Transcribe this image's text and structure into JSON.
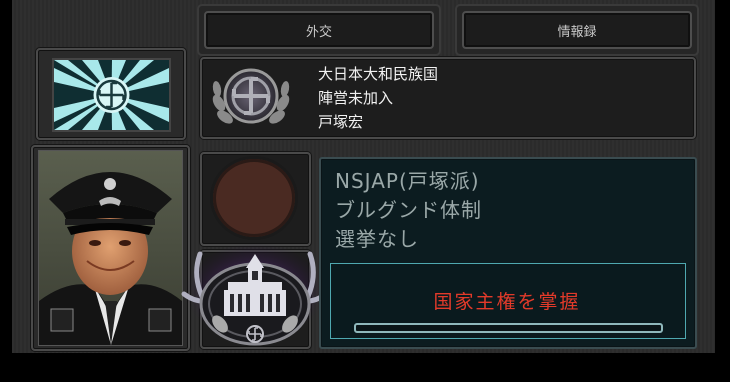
{
  "tabs": {
    "diplomacy": "外交",
    "intel": "情報録"
  },
  "country": {
    "name": "大日本大和民族国",
    "faction": "陣営未加入",
    "leader": "戸塚宏"
  },
  "politics": {
    "party": "NSJAP(戸塚派)",
    "government": "ブルグンド体制",
    "elections": "選挙なし"
  },
  "power_status": "国家主権を掌握",
  "colors": {
    "accent_teal": "#4fa8b0",
    "power_red": "#e23a2a",
    "party_color": "#4a2a22"
  },
  "icons": {
    "flag": "rising-sun-swastika-flag-icon",
    "emblem": "laurel-wreath-emblem-icon",
    "party_color_circle": "party-color-icon",
    "diet_building": "diet-building-emblem-icon"
  }
}
